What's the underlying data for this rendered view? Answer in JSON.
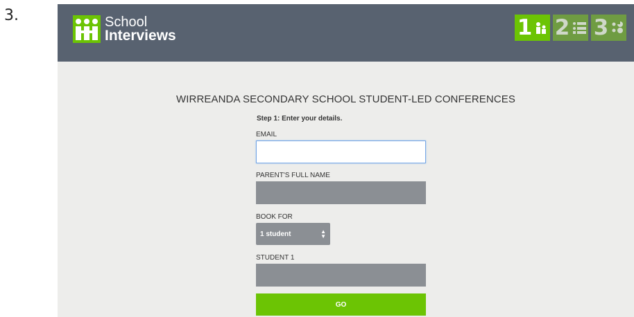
{
  "list_marker": "3.",
  "brand": {
    "line1": "School",
    "line2": "Interviews"
  },
  "steps": [
    {
      "number": "1",
      "icon": "people-icon",
      "state": "active"
    },
    {
      "number": "2",
      "icon": "list-icon",
      "state": "inactive"
    },
    {
      "number": "3",
      "icon": "pie-chart-icon",
      "state": "inactive"
    }
  ],
  "page_title": "WIRREANDA SECONDARY SCHOOL STUDENT-LED CONFERENCES",
  "form": {
    "step_label": "Step 1: Enter your details.",
    "email_label": "EMAIL",
    "email_value": "",
    "parent_label": "PARENT'S FULL NAME",
    "parent_value": "",
    "book_for_label": "BOOK FOR",
    "book_for_selected": "1 student",
    "student1_label": "STUDENT 1",
    "student1_value": "",
    "go_label": "GO"
  },
  "colors": {
    "header": "#586270",
    "accent": "#6cc404",
    "panel": "#ededeb",
    "field": "#8b8f94"
  }
}
